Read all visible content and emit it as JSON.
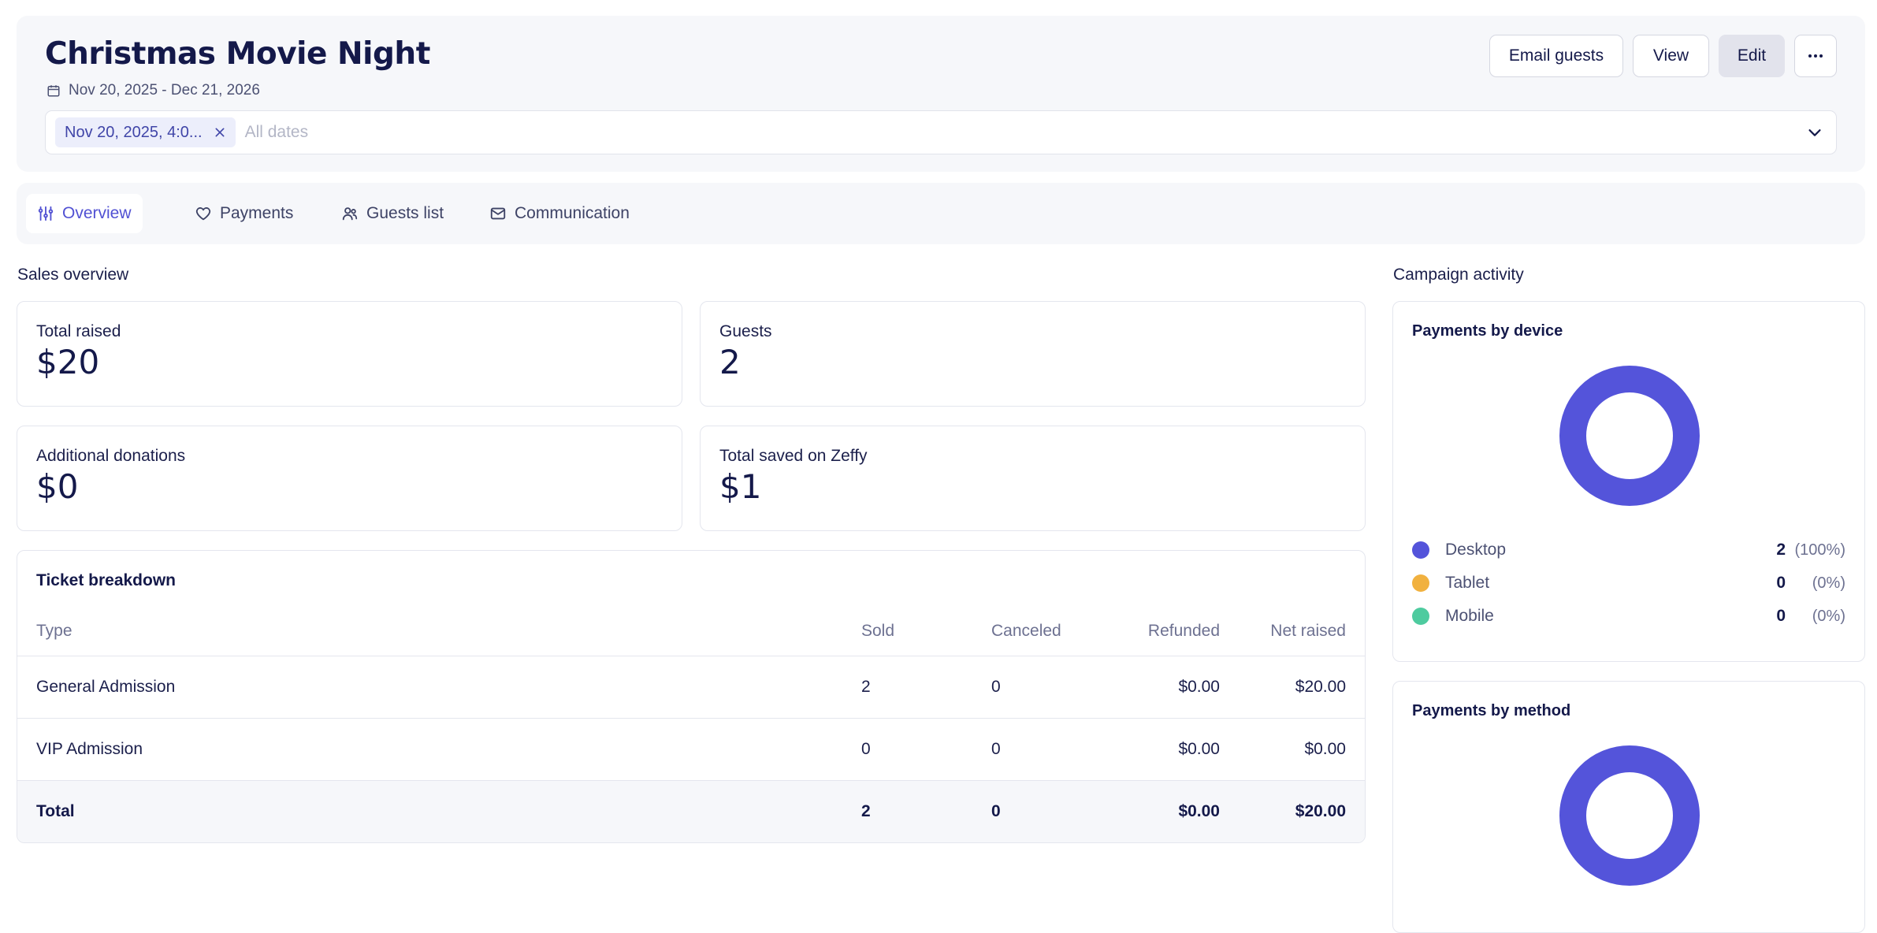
{
  "header": {
    "title": "Christmas Movie Night",
    "date_range": "Nov 20, 2025 - Dec 21, 2026",
    "buttons": {
      "email_guests": "Email guests",
      "view": "View",
      "edit": "Edit"
    },
    "date_filter": {
      "chip": "Nov 20, 2025, 4:0...",
      "placeholder": "All dates"
    }
  },
  "tabs": [
    {
      "label": "Overview",
      "icon": "sliders-icon",
      "active": true
    },
    {
      "label": "Payments",
      "icon": "heart-icon",
      "active": false
    },
    {
      "label": "Guests list",
      "icon": "users-icon",
      "active": false
    },
    {
      "label": "Communication",
      "icon": "mail-icon",
      "active": false
    }
  ],
  "sales_overview": {
    "label": "Sales overview",
    "stats": [
      {
        "label": "Total raised",
        "value": "$20"
      },
      {
        "label": "Guests",
        "value": "2"
      },
      {
        "label": "Additional donations",
        "value": "$0"
      },
      {
        "label": "Total saved on Zeffy",
        "value": "$1"
      }
    ]
  },
  "ticket_breakdown": {
    "title": "Ticket breakdown",
    "columns": [
      "Type",
      "Sold",
      "Canceled",
      "Refunded",
      "Net raised"
    ],
    "rows": [
      {
        "type": "General Admission",
        "sold": "2",
        "canceled": "0",
        "refunded": "$0.00",
        "net": "$20.00"
      },
      {
        "type": "VIP Admission",
        "sold": "0",
        "canceled": "0",
        "refunded": "$0.00",
        "net": "$0.00"
      }
    ],
    "total": {
      "type": "Total",
      "sold": "2",
      "canceled": "0",
      "refunded": "$0.00",
      "net": "$20.00"
    }
  },
  "campaign_activity": {
    "label": "Campaign activity",
    "by_device": {
      "title": "Payments by device",
      "legend": [
        {
          "label": "Desktop",
          "count": "2",
          "pct": "(100%)",
          "color": "#5454da",
          "fraction": 1.0
        },
        {
          "label": "Tablet",
          "count": "0",
          "pct": "(0%)",
          "color": "#f1b13f",
          "fraction": 0
        },
        {
          "label": "Mobile",
          "count": "0",
          "pct": "(0%)",
          "color": "#4ecb9f",
          "fraction": 0
        }
      ]
    },
    "by_method": {
      "title": "Payments by method",
      "color": "#5454da"
    }
  }
}
